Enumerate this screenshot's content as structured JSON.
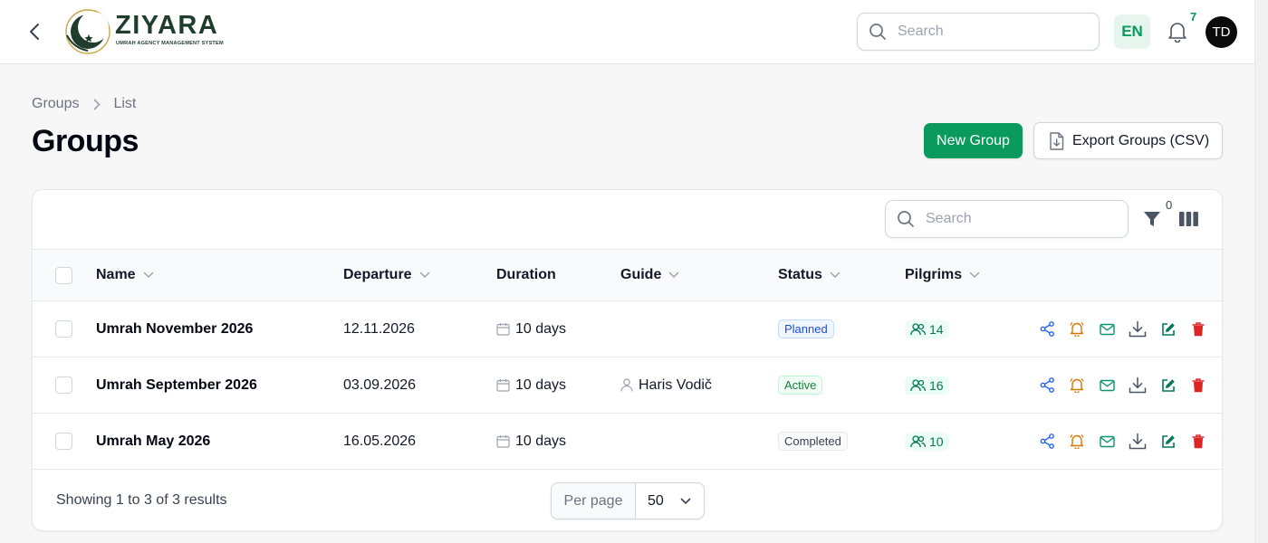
{
  "header": {
    "logo_title": "ZIYARA",
    "logo_subtitle": "UMRAH AGENCY MANAGEMENT SYSTEM",
    "search_placeholder": "Search",
    "language": "EN",
    "notifications_count": "7",
    "avatar_initials": "TD"
  },
  "breadcrumb": {
    "items": [
      "Groups",
      "List"
    ]
  },
  "page": {
    "title": "Groups",
    "new_button": "New Group",
    "export_button": "Export Groups (CSV)"
  },
  "table": {
    "search_placeholder": "Search",
    "filter_count": "0",
    "columns": [
      "Name",
      "Departure",
      "Duration",
      "Guide",
      "Status",
      "Pilgrims"
    ],
    "rows": [
      {
        "name": "Umrah November 2026",
        "departure": "12.11.2026",
        "duration": "10 days",
        "guide": "",
        "status": "Planned",
        "pilgrims": "14"
      },
      {
        "name": "Umrah September 2026",
        "departure": "03.09.2026",
        "duration": "10 days",
        "guide": "Haris Vodič",
        "status": "Active",
        "pilgrims": "16"
      },
      {
        "name": "Umrah May 2026",
        "departure": "16.05.2026",
        "duration": "10 days",
        "guide": "",
        "status": "Completed",
        "pilgrims": "10"
      }
    ],
    "row_actions": [
      "share-icon",
      "bell-icon",
      "mail-icon",
      "download-icon",
      "edit-icon",
      "trash-icon"
    ],
    "footer_text": "Showing 1 to 3 of 3 results",
    "per_page_label": "Per page",
    "per_page_value": "50"
  },
  "colors": {
    "primary": "#0b9a5e",
    "share": "#2563eb",
    "bell": "#d97706",
    "mail": "#059669",
    "download": "#4b5563",
    "edit": "#047857",
    "trash": "#dc2626",
    "logo": "#1f3d2c"
  }
}
